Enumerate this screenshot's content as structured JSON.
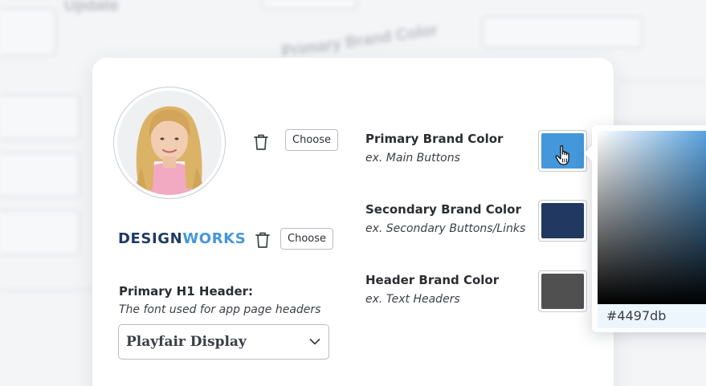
{
  "background": {
    "update_label": "Update",
    "field_label": "Primary Brand Color"
  },
  "profile": {
    "avatar_alt": "profile photo",
    "choose_label": "Choose"
  },
  "logo": {
    "part_one": "DESIGN",
    "part_two": "WORKS",
    "choose_label": "Choose"
  },
  "header_font": {
    "label": "Primary H1 Header:",
    "description": "The font used for app page headers",
    "selected_value": "Playfair Display"
  },
  "brand_colors": [
    {
      "label": "Primary Brand Color",
      "hint": "ex. Main Buttons",
      "color": "#4497db"
    },
    {
      "label": "Secondary Brand Color",
      "hint": "ex. Secondary Buttons/Links",
      "color": "#213961"
    },
    {
      "label": "Header Brand Color",
      "hint": "ex. Text Headers",
      "color": "#505050"
    }
  ],
  "color_picker": {
    "hex_value": "#4497db",
    "base_hue": "#4497db"
  },
  "colors": {
    "accent": "#4497db",
    "logo_dark": "#1f3a64",
    "text": "#2b2d31"
  }
}
